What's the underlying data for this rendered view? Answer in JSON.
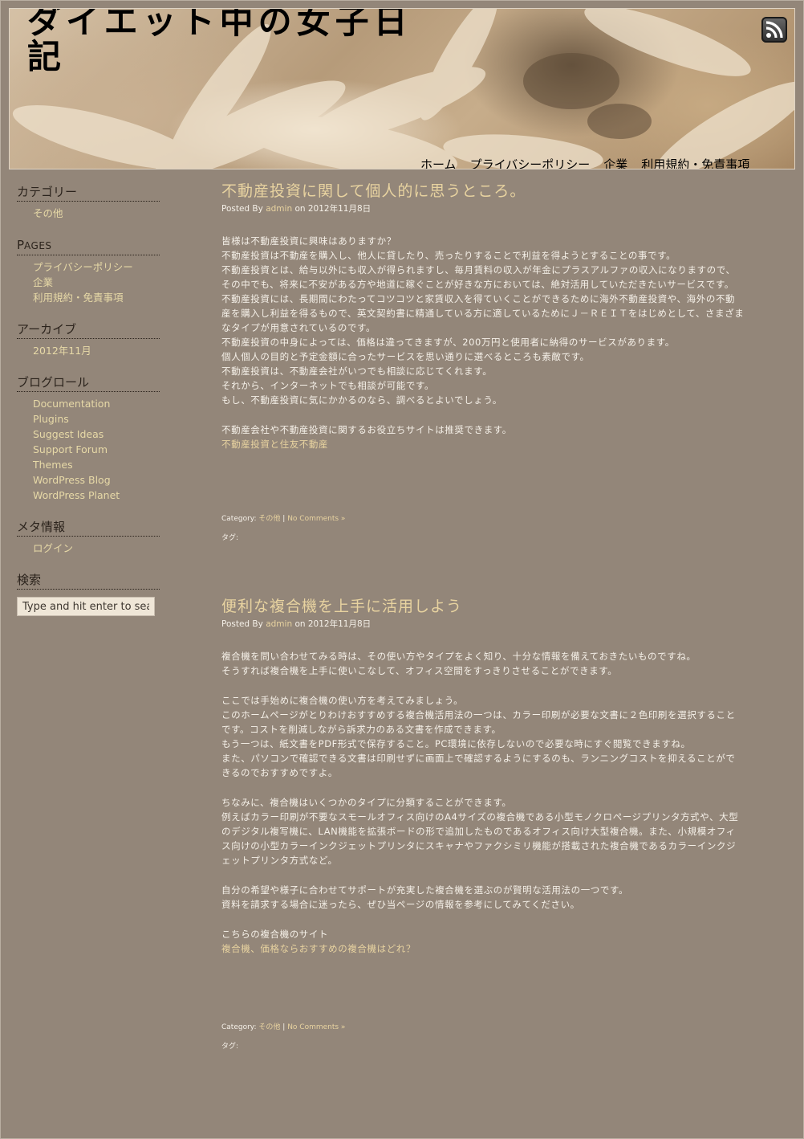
{
  "site": {
    "title": "ダイエット中の女子日記"
  },
  "icons": {
    "rss": "rss-feed-icon"
  },
  "nav": {
    "items": [
      "ホーム",
      "プライバシーポリシー",
      "企業",
      "利用規約・免責事項"
    ]
  },
  "sidebar": {
    "categories": {
      "title": "カテゴリー",
      "items": [
        "その他"
      ]
    },
    "pages": {
      "title_first": "P",
      "title_rest": "AGES",
      "items": [
        "プライバシーポリシー",
        "企業",
        "利用規約・免責事項"
      ]
    },
    "archives": {
      "title": "アーカイブ",
      "items": [
        "2012年11月"
      ]
    },
    "blogroll": {
      "title": "ブログロール",
      "items": [
        "Documentation",
        "Plugins",
        "Suggest Ideas",
        "Support Forum",
        "Themes",
        "WordPress Blog",
        "WordPress Planet"
      ]
    },
    "meta": {
      "title": "メタ情報",
      "items": [
        "ログイン"
      ]
    },
    "search": {
      "title": "検索",
      "placeholder": "Type and hit enter to search"
    }
  },
  "posts": [
    {
      "title": "不動産投資に関して個人的に思うところ。",
      "posted_by": "Posted By",
      "author": "admin",
      "on": "on 2012年11月8日",
      "paragraphs": [
        [
          "皆様は不動産投資に興味はありますか？",
          "不動産投資は不動産を購入し、他人に貸したり、売ったりすることで利益を得ようとすることの事です。",
          "不動産投資とは、給与以外にも収入が得られますし、毎月賃料の収入が年金にプラスアルファの収入になりますので、その中でも、将来に不安がある方や地道に稼ぐことが好きな方においては、絶対活用していただきたいサービスです。",
          "不動産投資には、長期間にわたってコツコツと家賃収入を得ていくことができるために海外不動産投資や、海外の不動産を購入し利益を得るもので、英文契約書に精通している方に適しているためにＪ－ＲＥＩＴをはじめとして、さまざまなタイプが用意されているのです。",
          "不動産投資の中身によっては、価格は違ってきますが、200万円と使用者に納得のサービスがあります。",
          "個人個人の目的と予定金額に合ったサービスを思い通りに選べるところも素敵です。",
          "不動産投資は、不動産会社がいつでも相談に応じてくれます。",
          "それから、インターネットでも相談が可能です。",
          "もし、不動産投資に気にかかるのなら、調べるとよいでしょう。"
        ],
        [
          "不動産会社や不動産投資に関するお役立ちサイトは推奨できます。"
        ]
      ],
      "link_text": "不動産投資と住友不動産",
      "category_label": "Category:",
      "category": "その他",
      "sep": "|",
      "comments": "No Comments »",
      "tags_label": "タグ:"
    },
    {
      "title": "便利な複合機を上手に活用しよう",
      "posted_by": "Posted By",
      "author": "admin",
      "on": "on 2012年11月8日",
      "paragraphs": [
        [
          "複合機を問い合わせてみる時は、その使い方やタイプをよく知り、十分な情報を備えておきたいものですね。",
          "そうすれば複合機を上手に使いこなして、オフィス空間をすっきりさせることができます。"
        ],
        [
          "ここでは手始めに複合機の使い方を考えてみましょう。",
          "このホームページがとりわけおすすめする複合機活用法の一つは、カラー印刷が必要な文書に２色印刷を選択することです。コストを削減しながら訴求力のある文書を作成できます。",
          "もう一つは、紙文書をPDF形式で保存すること。PC環境に依存しないので必要な時にすぐ閲覧できますね。",
          "また、パソコンで確認できる文書は印刷せずに画面上で確認するようにするのも、ランニングコストを抑えることができるのでおすすめですよ。"
        ],
        [
          "ちなみに、複合機はいくつかのタイプに分類することができます。",
          "例えばカラー印刷が不要なスモールオフィス向けのA4サイズの複合機である小型モノクロページプリンタ方式や、大型のデジタル複写機に、LAN機能を拡張ボードの形で追加したものであるオフィス向け大型複合機。また、小規模オフィス向けの小型カラーインクジェットプリンタにスキャナやファクシミリ機能が搭載された複合機であるカラーインクジェットプリンタ方式など。"
        ],
        [
          "自分の希望や様子に合わせてサポートが充実した複合機を選ぶのが賢明な活用法の一つです。",
          "資料を請求する場合に迷ったら、ぜひ当ページの情報を参考にしてみてください。"
        ],
        [
          "こちらの複合機のサイト"
        ]
      ],
      "link_text": "複合機、価格ならおすすめの複合機はどれ？",
      "category_label": "Category:",
      "category": "その他",
      "sep": "|",
      "comments": "No Comments »",
      "tags_label": "タグ:"
    }
  ]
}
